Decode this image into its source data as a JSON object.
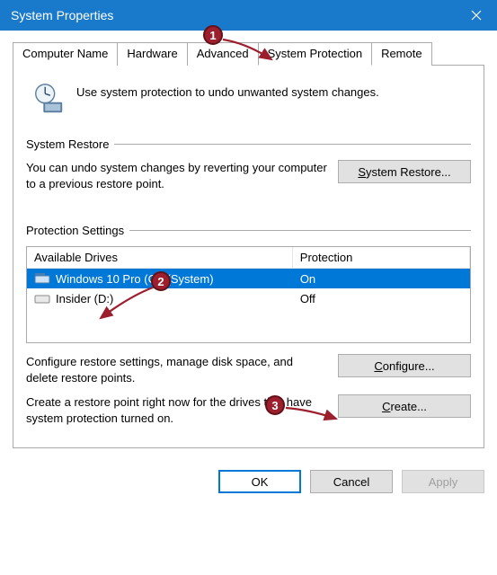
{
  "window": {
    "title": "System Properties"
  },
  "tabs": [
    {
      "label": "Computer Name"
    },
    {
      "label": "Hardware"
    },
    {
      "label": "Advanced"
    },
    {
      "label": "System Protection"
    },
    {
      "label": "Remote"
    }
  ],
  "header": {
    "text": "Use system protection to undo unwanted system changes."
  },
  "restore": {
    "group_title": "System Restore",
    "text": "You can undo system changes by reverting your computer to a previous restore point.",
    "button_prefix": "S",
    "button_rest": "ystem Restore..."
  },
  "protection": {
    "group_title": "Protection Settings",
    "col_drive": "Available Drives",
    "col_prot": "Protection",
    "drives": [
      {
        "name": "Windows 10 Pro (C:) (System)",
        "protection": "On",
        "selected": true
      },
      {
        "name": "Insider (D:)",
        "protection": "Off",
        "selected": false
      }
    ],
    "configure_text": "Configure restore settings, manage disk space, and delete restore points.",
    "configure_prefix": "C",
    "configure_rest": "onfigure...",
    "create_text": "Create a restore point right now for the drives that have system protection turned on.",
    "create_prefix": "C",
    "create_rest": "reate..."
  },
  "buttons": {
    "ok": "OK",
    "cancel": "Cancel",
    "apply": "Apply"
  },
  "annotations": {
    "n1": "1",
    "n2": "2",
    "n3": "3"
  }
}
